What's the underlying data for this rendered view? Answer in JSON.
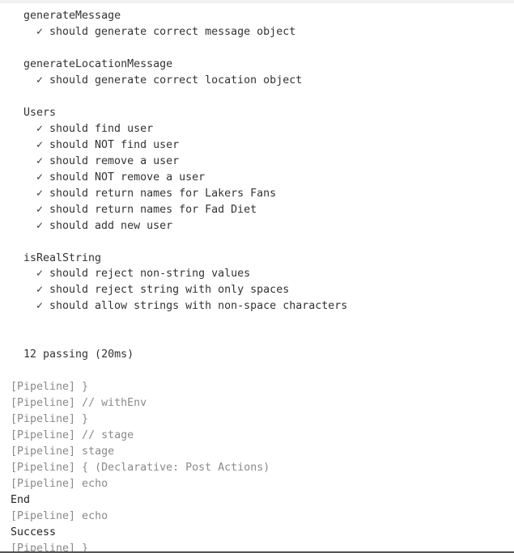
{
  "suites": [
    {
      "name": "generateMessage",
      "tests": [
        "should generate correct message object"
      ]
    },
    {
      "name": "generateLocationMessage",
      "tests": [
        "should generate correct location object"
      ]
    },
    {
      "name": "Users",
      "tests": [
        "should find user",
        "should NOT find user",
        "should remove a user",
        "should NOT remove a user",
        "should return names for Lakers Fans",
        "should return names for Fad Diet",
        "should add new user"
      ]
    },
    {
      "name": "isRealString",
      "tests": [
        "should reject non-string values",
        "should reject string with only spaces",
        "should allow strings with non-space characters"
      ]
    }
  ],
  "check_glyph": "✓",
  "summary": "12 passing (20ms)",
  "log": [
    {
      "kind": "pipeline",
      "text": "[Pipeline] }"
    },
    {
      "kind": "pipeline",
      "text": "[Pipeline] // withEnv"
    },
    {
      "kind": "pipeline",
      "text": "[Pipeline] }"
    },
    {
      "kind": "pipeline",
      "text": "[Pipeline] // stage"
    },
    {
      "kind": "pipeline",
      "text": "[Pipeline] stage"
    },
    {
      "kind": "pipeline",
      "text": "[Pipeline] { (Declarative: Post Actions)"
    },
    {
      "kind": "pipeline",
      "text": "[Pipeline] echo"
    },
    {
      "kind": "plain",
      "text": "End"
    },
    {
      "kind": "pipeline",
      "text": "[Pipeline] echo"
    },
    {
      "kind": "plain",
      "text": "Success"
    },
    {
      "kind": "pipeline",
      "text": "[Pipeline] }"
    }
  ],
  "colors": {
    "text": "#333333",
    "pipeline_text": "#8a8a8a",
    "background": "#ffffff"
  }
}
